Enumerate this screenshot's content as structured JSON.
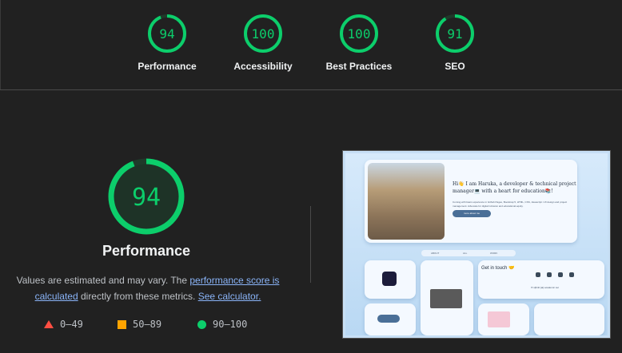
{
  "scores": [
    {
      "value": "94",
      "label": "Performance",
      "fraction": 0.94
    },
    {
      "value": "100",
      "label": "Accessibility",
      "fraction": 1.0
    },
    {
      "value": "100",
      "label": "Best Practices",
      "fraction": 1.0
    },
    {
      "value": "91",
      "label": "SEO",
      "fraction": 0.91
    }
  ],
  "main": {
    "score": "94",
    "fraction": 0.94,
    "title": "Performance",
    "desc_prefix": "Values are estimated and may vary. The ",
    "desc_link1": "performance score is calculated",
    "desc_middle": " directly from these metrics. ",
    "desc_link2": "See calculator."
  },
  "legend": {
    "fail": "0–49",
    "average": "50–89",
    "pass": "90–100"
  },
  "colors": {
    "pass": "#0cce6b",
    "average": "#ffa400",
    "fail": "#ff4e42",
    "link": "#8ab4f8",
    "background": "#212121"
  },
  "screenshot": {
    "hero_text": "Hi👋 I am Haruka, a developer & technical project manager💻 with a heart for education📚!",
    "hero_small": "Coming with basic experience in Github Pages, Bootstrap 5, HTML, CSS, Javascript. UX design and project management. Advocate for digital inclusion and educational equity.",
    "button": "more about me",
    "tabs": [
      "ABOUT",
      "ALL",
      "WORK"
    ],
    "contact_title": "Get in touch 🤝",
    "contact_email": "✉ sfjh4it [at] academic.net"
  }
}
